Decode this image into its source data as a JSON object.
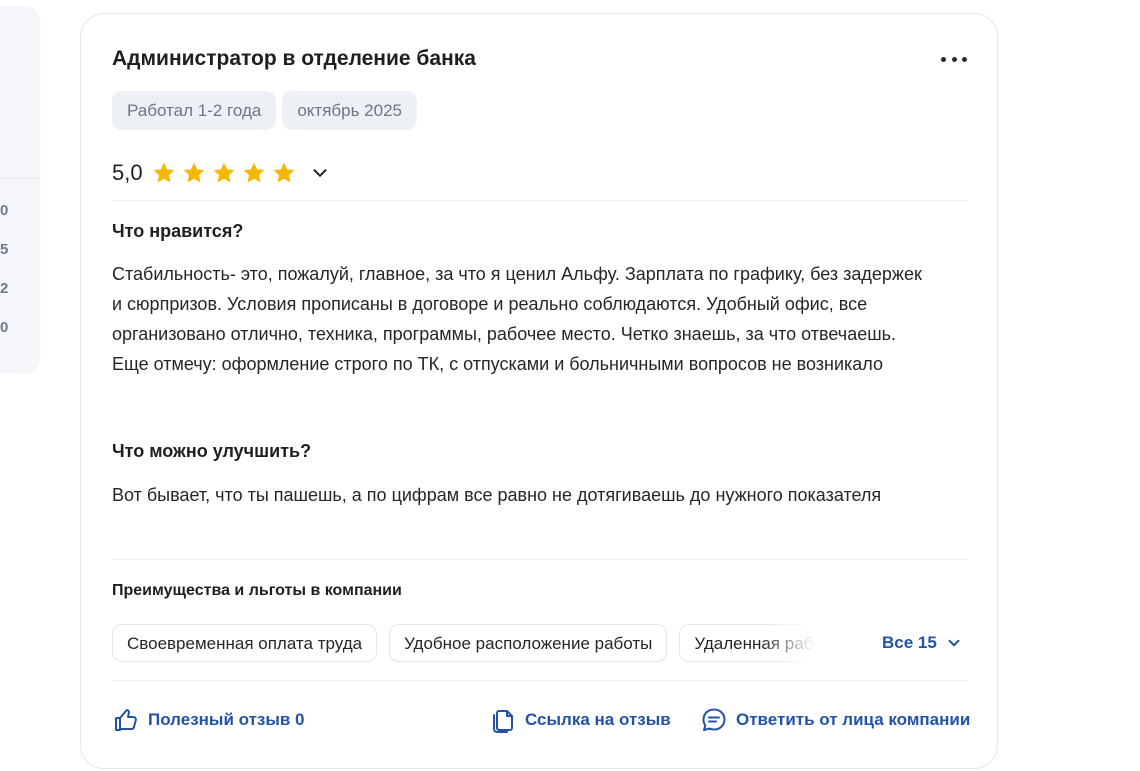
{
  "side_panel": {
    "numbers": [
      "0",
      "5",
      "2",
      "0"
    ]
  },
  "review": {
    "title": "Администратор в отделение банка",
    "tags": [
      "Работал 1-2 года",
      "октябрь 2025"
    ],
    "rating": {
      "value": "5,0",
      "stars": 5,
      "max_stars": 5,
      "star_color": "#f5b800"
    },
    "likes_title": "Что нравится?",
    "likes_text": "Стабильность- это, пожалуй, главное, за что я ценил Альфу. Зарплата по графику, без задержек и сюрпризов. Условия прописаны в договоре и реально соблюдаются. Удобный офис, все организовано отлично, техника, программы, рабочее место. Четко знаешь, за что отвечаешь. Еще отмечу: оформление строго по ТК, с отпусками и больничными вопросов не возникало",
    "improve_title": "Что можно улучшить?",
    "improve_text": "Вот бывает, что ты пашешь, а по цифрам все равно не дотягиваешь до нужного показателя",
    "benefits_title": "Преимущества и льготы в компании",
    "benefits": [
      "Своевременная оплата труда",
      "Удобное расположение работы",
      "Удаленная работа"
    ],
    "benefits_all_label": "Все 15",
    "actions": {
      "helpful": "Полезный отзыв 0",
      "link": "Ссылка на отзыв",
      "reply": "Ответить от лица компании"
    },
    "accent_color": "#2253a8"
  }
}
